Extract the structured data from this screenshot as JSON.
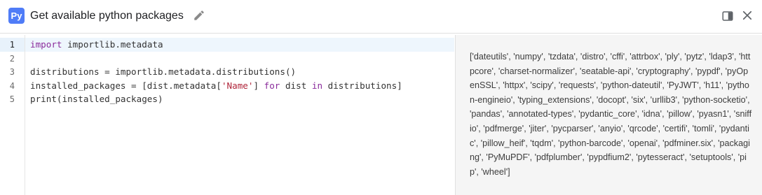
{
  "header": {
    "logo_text": "Py",
    "title": "Get available python packages",
    "edit_icon": "pencil-icon",
    "panel_icon": "side-panel-icon",
    "close_icon": "close-icon"
  },
  "editor": {
    "line_numbers": [
      "1",
      "2",
      "3",
      "4",
      "5"
    ],
    "active_line": 1,
    "lines": {
      "l1_kw": "import",
      "l1_rest": " importlib.metadata",
      "l2": "",
      "l3": "distributions = importlib.metadata.distributions()",
      "l4_a": "installed_packages = [dist.metadata[",
      "l4_str": "'Name'",
      "l4_b": "] ",
      "l4_kw1": "for",
      "l4_c": " dist ",
      "l4_kw2": "in",
      "l4_d": " distributions]",
      "l5": "print(installed_packages)"
    }
  },
  "output": {
    "text": "['dateutils', 'numpy', 'tzdata', 'distro', 'cffi', 'attrbox', 'ply', 'pytz', 'ldap3', 'httpcore', 'charset-normalizer', 'seatable-api', 'cryptography', 'pypdf', 'pyOpenSSL', 'httpx', 'scipy', 'requests', 'python-dateutil', 'PyJWT', 'h11', 'python-engineio', 'typing_extensions', 'docopt', 'six', 'urllib3', 'python-socketio', 'pandas', 'annotated-types', 'pydantic_core', 'idna', 'pillow', 'pyasn1', 'sniffio', 'pdfmerge', 'jiter', 'pycparser', 'anyio', 'qrcode', 'certifi', 'tomli', 'pydantic', 'pillow_heif', 'tqdm', 'python-barcode', 'openai', 'pdfminer.six', 'packaging', 'PyMuPDF', 'pdfplumber', 'pypdfium2', 'pytesseract', 'setuptools', 'pip', 'wheel']"
  },
  "colors": {
    "logo_bg": "#4f7cf7",
    "keyword": "#8a2b9b",
    "string": "#b0253a",
    "active_line_bg": "#eef6fd",
    "output_bg": "#f5f5f5"
  }
}
